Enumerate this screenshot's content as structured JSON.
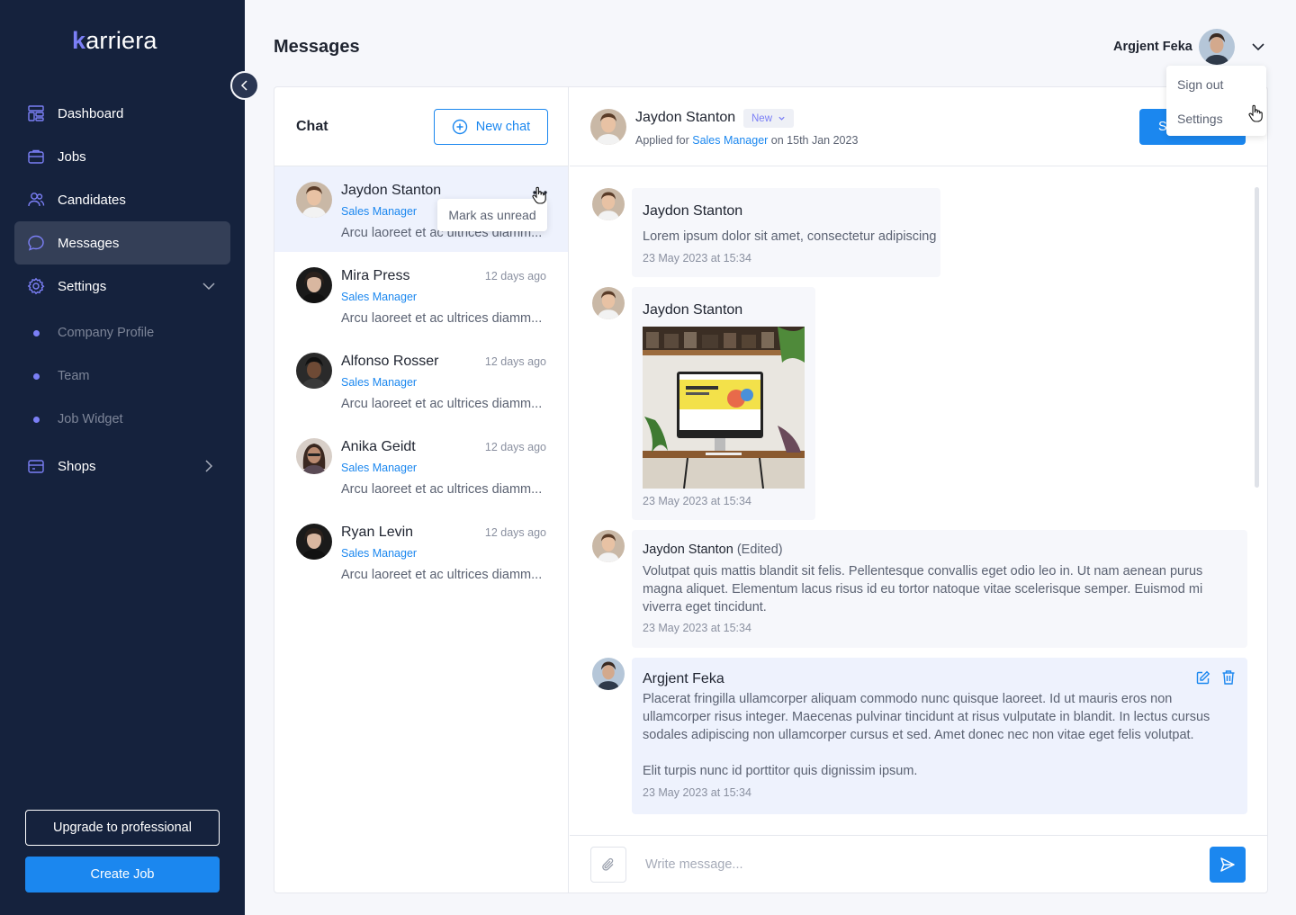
{
  "brand": {
    "logo_k": "k",
    "logo_rest": "arriera"
  },
  "sidebar": {
    "items": [
      {
        "label": "Dashboard",
        "icon": "dashboard-icon"
      },
      {
        "label": "Jobs",
        "icon": "briefcase-icon"
      },
      {
        "label": "Candidates",
        "icon": "users-icon"
      },
      {
        "label": "Messages",
        "icon": "chat-icon",
        "active": true
      },
      {
        "label": "Settings",
        "icon": "gear-icon",
        "expanded": true
      }
    ],
    "settings_sub": [
      "Company Profile",
      "Team",
      "Job Widget"
    ],
    "shops": {
      "label": "Shops",
      "icon": "store-icon"
    },
    "upgrade_label": "Upgrade to professional",
    "create_job_label": "Create Job"
  },
  "header": {
    "title": "Messages",
    "user_name": "Argjent Feka"
  },
  "user_menu": {
    "sign_out": "Sign out",
    "settings": "Settings"
  },
  "chat_list": {
    "title": "Chat",
    "new_chat_label": "New chat",
    "tooltip": "Mark as unread",
    "items": [
      {
        "name": "Jaydon Stanton",
        "role": "Sales Manager",
        "preview": "Arcu laoreet et ac ultrices diamm...",
        "time": "",
        "active": true
      },
      {
        "name": "Mira Press",
        "role": "Sales Manager",
        "preview": "Arcu laoreet et ac ultrices diamm...",
        "time": "12 days ago"
      },
      {
        "name": "Alfonso Rosser",
        "role": "Sales Manager",
        "preview": "Arcu laoreet et ac ultrices diamm...",
        "time": "12 days ago"
      },
      {
        "name": "Anika Geidt",
        "role": "Sales Manager",
        "preview": "Arcu laoreet et ac ultrices diamm...",
        "time": "12 days ago"
      },
      {
        "name": "Ryan Levin",
        "role": "Sales Manager",
        "preview": "Arcu laoreet et ac ultrices diamm...",
        "time": "12 days ago"
      }
    ]
  },
  "conversation": {
    "name": "Jaydon Stanton",
    "status": "New",
    "applied_prefix": "Applied for ",
    "applied_job": "Sales Manager",
    "applied_suffix": " on 15th Jan 2023",
    "action_label": "S",
    "messages": [
      {
        "author": "Jaydon Stanton",
        "text": "Lorem ipsum dolor sit amet, consectetur adipiscing",
        "time": "23 May 2023 at 15:34"
      },
      {
        "author": "Jaydon Stanton",
        "image": "workspace-photo",
        "time": "23 May 2023 at 15:34"
      },
      {
        "author": "Jaydon Stanton",
        "edited": "(Edited)",
        "text": "Volutpat quis mattis blandit sit felis. Pellentesque convallis eget odio leo in. Ut nam aenean purus magna aliquet. Elementum lacus risus id eu tortor natoque vitae scelerisque semper. Euismod mi viverra eget tincidunt.",
        "time": "23 May 2023 at 15:34"
      },
      {
        "author": "Argjent Feka",
        "text": "Placerat fringilla ullamcorper aliquam commodo nunc quisque laoreet. Id ut mauris eros non ullamcorper risus integer. Maecenas pulvinar tincidunt at risus vulputate in blandit. In lectus cursus sodales adipiscing non ullamcorper cursus et sed. Amet donec nec non vitae eget felis volutpat.",
        "text2": "Elit turpis nunc id porttitor quis dignissim ipsum.",
        "time": "23 May 2023 at 15:34",
        "mine": true
      }
    ],
    "composer_placeholder": "Write message..."
  },
  "colors": {
    "sidebar_bg": "#15223d",
    "accent": "#1b87ef",
    "purple": "#7b7ff6",
    "active_bg": "#343f57"
  }
}
